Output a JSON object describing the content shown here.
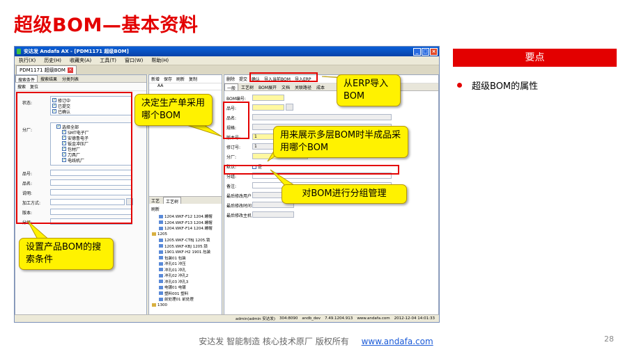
{
  "slide": {
    "title": "超级BOM—基本资料",
    "key_points_header": "要点",
    "key_points": [
      "超级BOM的属性"
    ],
    "footer_text": "安达发  智能制造 核心技术原厂   版权所有",
    "footer_link": "www.andafa.com",
    "page_number": "28"
  },
  "app": {
    "window_title": "安达发 Andafa AX - [PDM1171 超级BOM]",
    "menu": [
      "执行(X)",
      "历史(H)",
      "收藏夹(A)",
      "工具(T)",
      "窗口(W)",
      "帮助(H)"
    ],
    "doc_tab": "PDM1171 超级BOM",
    "left": {
      "tabs": [
        "搜索条件",
        "搜索结果",
        "分类列表"
      ],
      "toolbar": [
        "搜索",
        "复位"
      ],
      "status_label": "状态:",
      "status_options": [
        "修订中",
        "已提交",
        "已确认"
      ],
      "branch_label": "分厂:",
      "branch_options": [
        "选择全部",
        "SMT电子厂",
        "安德鲁电子",
        "钣金冲压厂",
        "包材厂",
        "刀具厂",
        "电线机厂"
      ],
      "fields": [
        "品号:",
        "品名:",
        "说明:",
        "加工方式:",
        "版本:",
        "分组:"
      ]
    },
    "middle": {
      "toolbar": [
        "新增",
        "保存",
        "刷新",
        "复制"
      ],
      "header": "AA",
      "tabs": [
        "工艺",
        "工艺树"
      ],
      "tree_refresh": "刷新",
      "tree_items": [
        "1204.WKF-F12 1204.螺帽",
        "1204.WKF-F13 1204.螺帽",
        "1204.WKF-F14 1204.螺帽",
        "1205",
        "1205.WKF-CTBJ 1205.锁",
        "1205.WKF-KBJ 1205.锁",
        "1901.WKF-H2 1901.包装",
        "包装01 包装",
        "冲孔01 冲压",
        "冲孔01 冲孔",
        "冲孔02 冲孔2",
        "冲孔03 冲孔3",
        "电镀01 电镀",
        "塑料001 塑料",
        "前处理01 前处理",
        "1300"
      ]
    },
    "right": {
      "toolbar": [
        "删除",
        "提交",
        "确认",
        "导入当前BOM",
        "导入ERP"
      ],
      "tabs": [
        "一般",
        "工艺树",
        "BOM展开",
        "文档",
        "关联路径",
        "成本"
      ],
      "fields": [
        "BOM编号:",
        "品号:",
        "品名:",
        "规格:",
        "版本号:",
        "修订号:",
        "分厂:",
        "默认:",
        "分组:",
        "备注:",
        "最后修改用户",
        "最后修改时间",
        "最后修改主机"
      ],
      "version_value": "1",
      "revision_value": "1",
      "default_value": "是"
    },
    "status_bar": [
      "admin(admin 安达发)",
      "304:8090",
      "andb_dev",
      "7.49.1204.913",
      "www.andafa.com",
      "2012-12-04 14:01:33"
    ]
  },
  "callouts": {
    "production_bom": "决定生产单采用哪个BOM",
    "erp_import": "从ERP导入BOM",
    "multilevel": "用来展示多层BOM时半成品采用哪个BOM",
    "grouping": "对BOM进行分组管理",
    "search": "设置产品BOM的搜索条件"
  },
  "colors": {
    "title_red": "#e30000",
    "callout_yellow": "#fff200",
    "link_blue": "#1a5ad8"
  }
}
